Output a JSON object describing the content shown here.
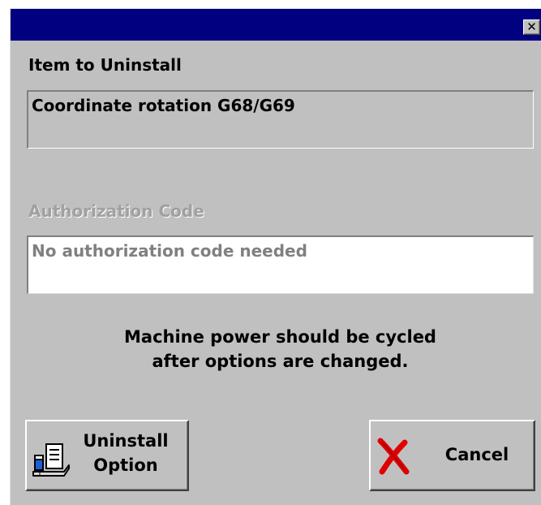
{
  "dialog": {
    "close_glyph": "✕",
    "close_icon": "close-icon",
    "titlebar_color": "#000080",
    "background_color": "#c0c0c0"
  },
  "item": {
    "label": "Item to Uninstall",
    "value": "Coordinate rotation G68/G69"
  },
  "authorization": {
    "label": "Authorization Code",
    "value": "No authorization code needed",
    "enabled": false
  },
  "notice": {
    "line1": "Machine power should be cycled",
    "line2": "after options are changed."
  },
  "buttons": {
    "uninstall": {
      "line1": "Uninstall",
      "line2": "Option",
      "icon": "uninstall-option-icon"
    },
    "cancel": {
      "label": "Cancel",
      "icon": "red-x-icon",
      "icon_color": "#e00000"
    }
  }
}
